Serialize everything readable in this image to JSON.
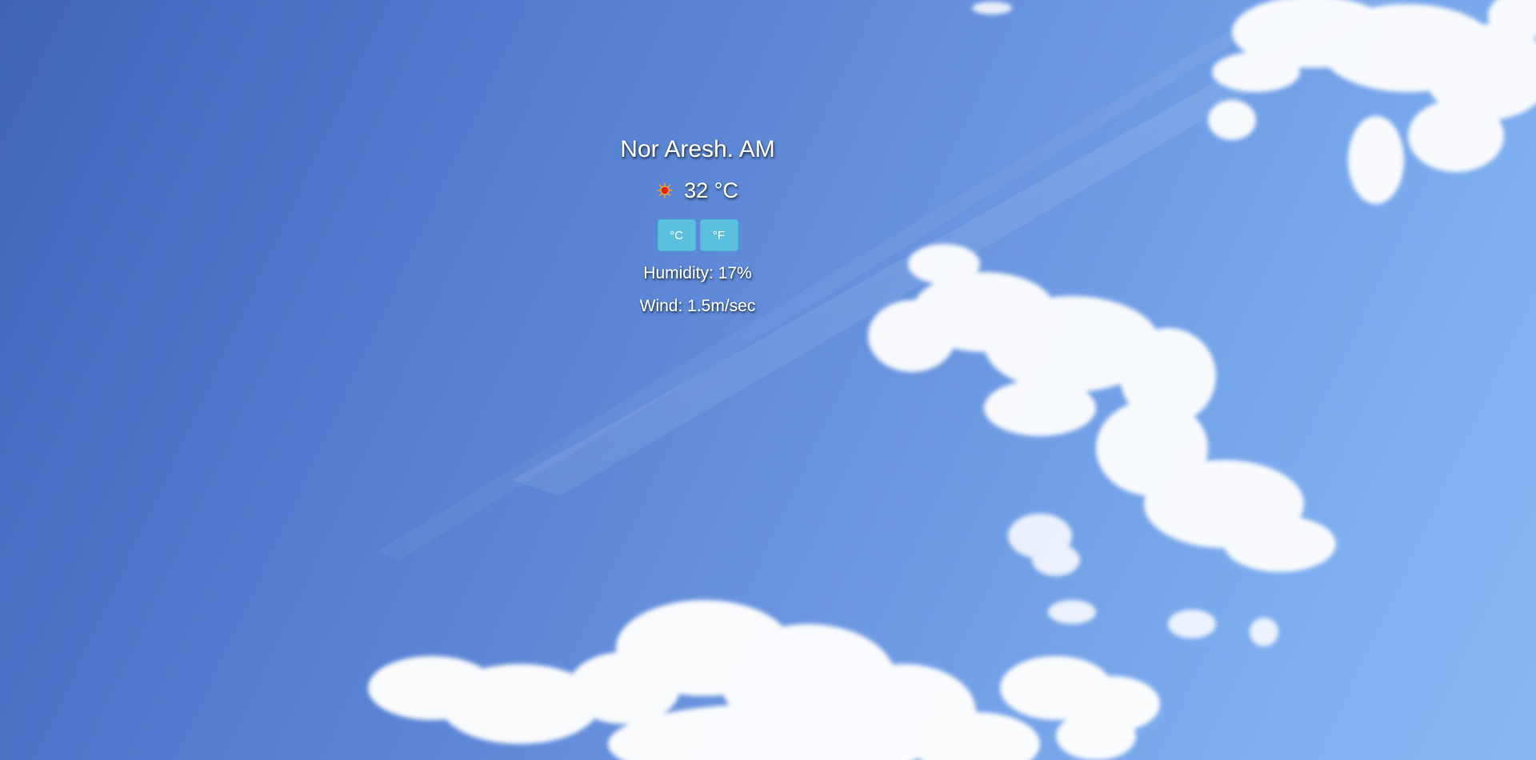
{
  "weather": {
    "location": "Nor Aresh. AM",
    "temperature": "32 °C",
    "icon": "sun-icon",
    "units": {
      "celsius_label": "°C",
      "fahrenheit_label": "°F"
    },
    "humidity": "Humidity: 17%",
    "wind": "Wind: 1.5m/sec"
  },
  "colors": {
    "button_bg": "#5bc0de",
    "text": "#ffffff",
    "sky_top": "#3f64b8",
    "sky_bottom": "#86b6f2"
  }
}
